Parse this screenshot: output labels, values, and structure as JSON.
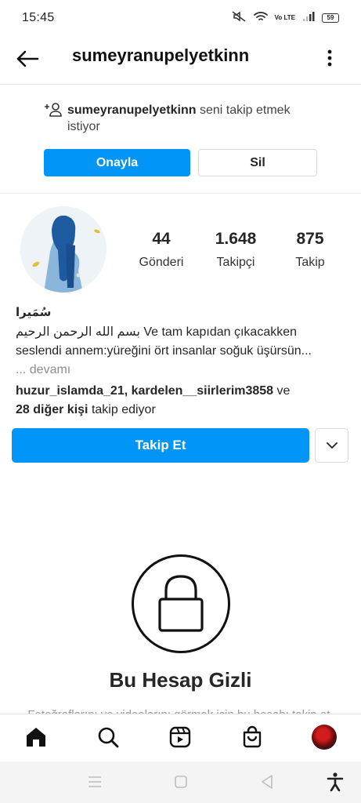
{
  "status_bar": {
    "time": "15:45",
    "network": "Vo LTE",
    "battery": "59"
  },
  "header": {
    "username": "sumeyranupelyetkinn"
  },
  "follow_request": {
    "username": "sumeyranupelyetkinn",
    "text": "seni takip etmek",
    "text_cont": "istiyor",
    "approve_label": "Onayla",
    "delete_label": "Sil"
  },
  "profile": {
    "stats": [
      {
        "value": "44",
        "label": "Gönderi"
      },
      {
        "value": "1.648",
        "label": "Takipçi"
      },
      {
        "value": "875",
        "label": "Takip"
      }
    ],
    "display_name": "سُمَيرا",
    "bio_line1": "بسم الله الرحمن الرحيم Ve tam kapıdan çıkacakken",
    "bio_line2": "seslendi annem:yüreğini ört insanlar soğuk üşürsün...",
    "bio_more": "... devamı",
    "followed_by_users": "huzur_islamda_21, kardelen__siirlerim3858",
    "followed_by_and": " ve",
    "followed_by_others": "28 diğer kişi",
    "followed_by_suffix": " takip ediyor",
    "follow_label": "Takip Et"
  },
  "private_account": {
    "title": "Bu Hesap Gizli",
    "subtitle": "Fotoğraflarını ve videolarını görmek için bu hesabı takip et."
  },
  "colors": {
    "accent": "#0095f6",
    "text": "#262626",
    "muted": "#8e8e8e",
    "border": "#dbdbdb"
  },
  "icons": {
    "back": "arrow-left-icon",
    "more": "more-vertical-icon",
    "request": "add-user-icon",
    "suggest": "chevron-down-icon",
    "lock": "lock-icon",
    "nav": [
      "home-icon",
      "search-icon",
      "reels-icon",
      "shop-icon",
      "profile-avatar"
    ],
    "system": [
      "menu-icon",
      "home-square-icon",
      "back-triangle-icon",
      "accessibility-icon"
    ]
  }
}
